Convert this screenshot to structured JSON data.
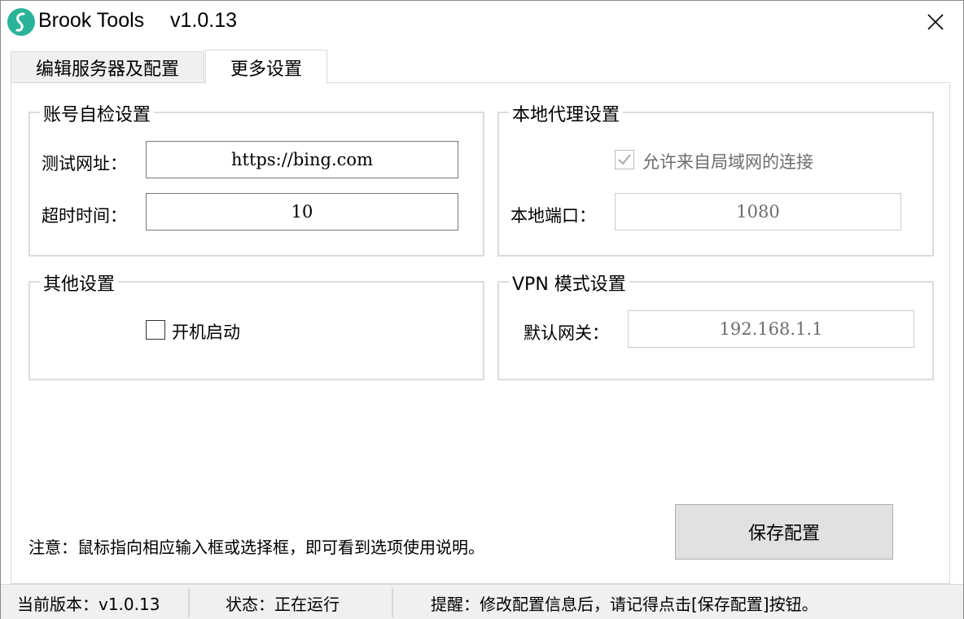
{
  "window": {
    "app_name": "Brook Tools",
    "version": "v1.0.13",
    "icon": "brook-logo-icon",
    "close_icon": "close-icon"
  },
  "tabs": [
    {
      "label": "编辑服务器及配置",
      "active": false
    },
    {
      "label": "更多设置",
      "active": true
    }
  ],
  "account_check": {
    "title": "账号自检设置",
    "test_url_label": "测试网址：",
    "test_url_value": "https://bing.com",
    "timeout_label": "超时时间：",
    "timeout_value": "10"
  },
  "local_proxy": {
    "title": "本地代理设置",
    "allow_lan_label": "允许来自局域网的连接",
    "allow_lan_checked": true,
    "port_label": "本地端口：",
    "port_value": "1080"
  },
  "other": {
    "title": "其他设置",
    "autostart_label": "开机启动",
    "autostart_checked": false
  },
  "vpn": {
    "title": "VPN 模式设置",
    "gateway_label": "默认网关：",
    "gateway_value": "192.168.1.1"
  },
  "note": "注意：鼠标指向相应输入框或选择框，即可看到选项使用说明。",
  "save_button": "保存配置",
  "status_bar": {
    "version_text": "当前版本：v1.0.13",
    "state_text": "状态：正在运行",
    "hint_text": "提醒：修改配置信息后，请记得点击[保存配置]按钮。"
  },
  "colors": {
    "accent": "#2bb39a",
    "statusbar_bg": "#f0f0f0",
    "button_bg": "#e1e1e1"
  }
}
